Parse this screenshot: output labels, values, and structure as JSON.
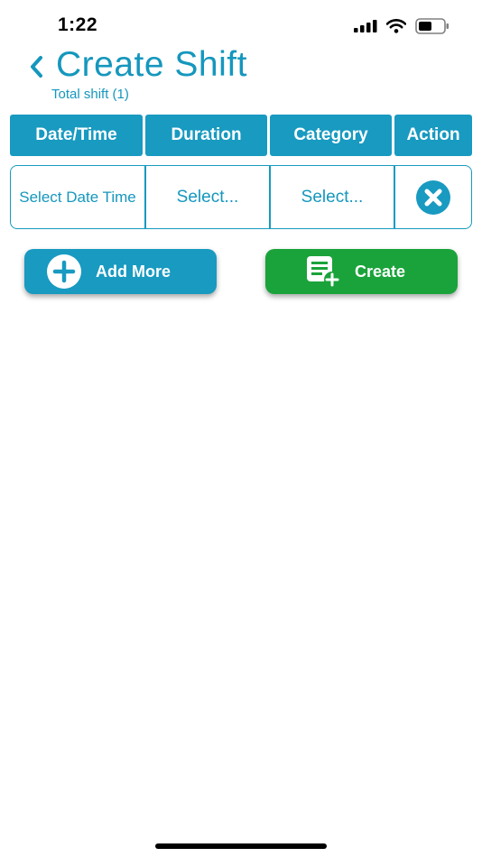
{
  "status_bar": {
    "time": "1:22",
    "icons": [
      "signal-icon",
      "wifi-icon",
      "battery-icon"
    ]
  },
  "header": {
    "back_icon": "chevron-left-icon",
    "title": "Create Shift",
    "subtitle": "Total shift (1)"
  },
  "table": {
    "columns": [
      "Date/Time",
      "Duration",
      "Category",
      "Action"
    ],
    "rows": [
      {
        "date_time": "Select Date Time",
        "duration": "Select...",
        "category": "Select...",
        "action_icon": "close-circle-icon"
      }
    ]
  },
  "buttons": {
    "add_more": {
      "label": "Add More",
      "icon": "plus-circle-icon"
    },
    "create": {
      "label": "Create",
      "icon": "document-add-icon"
    }
  },
  "colors": {
    "accent": "#189ac1",
    "create_green": "#1aa33a",
    "background": "#ffffff"
  }
}
